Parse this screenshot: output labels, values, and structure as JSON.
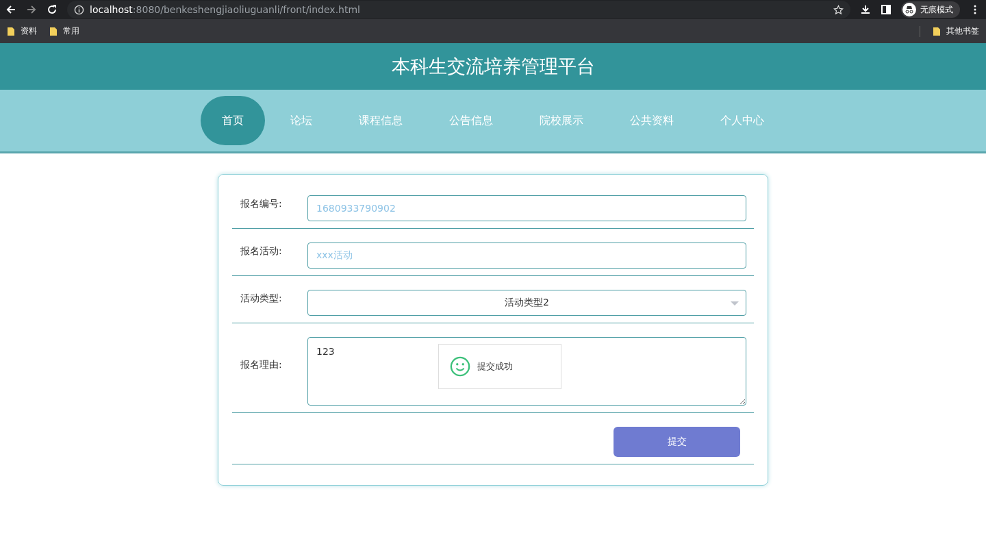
{
  "browser": {
    "url_host": "localhost",
    "url_rest": ":8080/benkeshengjiaoliuguanli/front/index.html",
    "profile": "无痕模式",
    "bookmarks": [
      "资料",
      "常用"
    ],
    "other_bookmarks": "其他书签"
  },
  "site": {
    "title": "本科生交流培养管理平台"
  },
  "nav": [
    {
      "label": "首页",
      "selected": true
    },
    {
      "label": "论坛",
      "selected": false
    },
    {
      "label": "课程信息",
      "selected": false
    },
    {
      "label": "公告信息",
      "selected": false
    },
    {
      "label": "院校展示",
      "selected": false
    },
    {
      "label": "公共资料",
      "selected": false
    },
    {
      "label": "个人中心",
      "selected": false
    }
  ],
  "form": {
    "fields": [
      {
        "kind": "input",
        "label": "报名编号:",
        "value": "1680933790902",
        "readonly": true
      },
      {
        "kind": "input",
        "label": "报名活动:",
        "value": "xxx活动",
        "readonly": true
      },
      {
        "kind": "select",
        "label": "活动类型:",
        "value": "活动类型2"
      },
      {
        "kind": "textarea",
        "label": "报名理由:",
        "value": "123"
      }
    ],
    "submit": "提交"
  },
  "toast": {
    "message": "提交成功"
  }
}
